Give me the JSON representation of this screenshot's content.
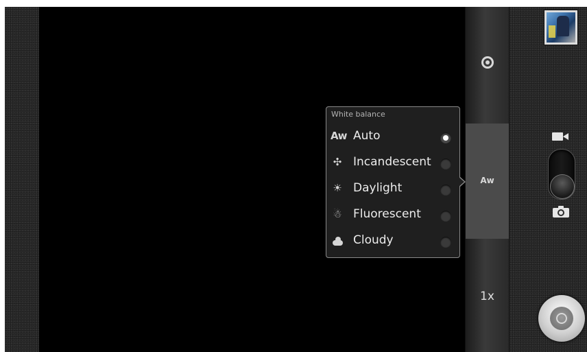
{
  "white_balance": {
    "title": "White balance",
    "selected": "Auto",
    "options": [
      {
        "label": "Auto",
        "icon": "auto-wb-icon",
        "icon_text": "Aw",
        "selected": true
      },
      {
        "label": "Incandescent",
        "icon": "incandescent-icon",
        "icon_text": "✣",
        "selected": false
      },
      {
        "label": "Daylight",
        "icon": "daylight-icon",
        "icon_text": "☀",
        "selected": false
      },
      {
        "label": "Fluorescent",
        "icon": "fluorescent-icon",
        "icon_text": "☃",
        "selected": false
      },
      {
        "label": "Cloudy",
        "icon": "cloudy-icon",
        "icon_text": "",
        "selected": false
      }
    ]
  },
  "settings_bar": {
    "wb_indicator": "Aw",
    "zoom": "1x"
  },
  "colors": {
    "background": "#2b2b2b",
    "viewfinder": "#000000",
    "popup_bg": "#1f1f1f",
    "popup_border": "#8a8a8a",
    "text": "#ececec",
    "selected_radio": "#ffffff"
  }
}
